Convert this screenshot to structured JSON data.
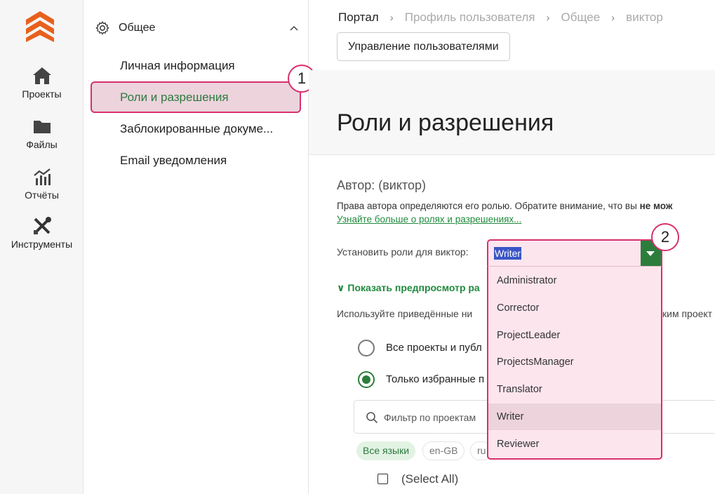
{
  "rail": {
    "items": [
      {
        "label": "Проекты"
      },
      {
        "label": "Файлы"
      },
      {
        "label": "Отчёты"
      },
      {
        "label": "Инструменты"
      }
    ]
  },
  "nav": {
    "section_title": "Общее",
    "items": [
      {
        "label": "Личная информация"
      },
      {
        "label": "Роли и разрешения"
      },
      {
        "label": "Заблокированные докуме..."
      },
      {
        "label": "Email уведомления"
      }
    ]
  },
  "breadcrumb": [
    "Портал",
    "Профиль пользователя",
    "Общее",
    "виктор"
  ],
  "manage_users_button": "Управление пользователями",
  "page_title": "Роли и разрешения",
  "author_heading": "Автор: (виктор)",
  "description": "Права автора определяются его ролью. Обратите внимание, что вы",
  "description_bold": "не мож",
  "learn_more_link": "Узнайте больше о ролях и разрешениях...",
  "set_roles_label": "Установить роли для виктор:",
  "role_select": {
    "value": "Writer",
    "options": [
      "Administrator",
      "Corrector",
      "ProjectLeader",
      "ProjectsManager",
      "Translator",
      "Writer",
      "Reviewer"
    ],
    "selected_index": 5
  },
  "preview_toggle": "Показать предпросмотр ра",
  "use_text": "Используйте приведённые ни",
  "use_text_tail": "ким проект",
  "radio_options": [
    {
      "label": "Все проекты и публ",
      "checked": false
    },
    {
      "label": "Только избранные п",
      "checked": true
    }
  ],
  "filter_placeholder": "Фильтр по проектам",
  "language_chips": [
    "Все языки",
    "en-GB",
    "ru"
  ],
  "select_all_label": "(Select All)",
  "annotations": [
    "1",
    "2"
  ],
  "colors": {
    "accent_green": "#2c7d3c",
    "highlight_pink": "#d8306e",
    "brand_orange": "#e8601c"
  }
}
